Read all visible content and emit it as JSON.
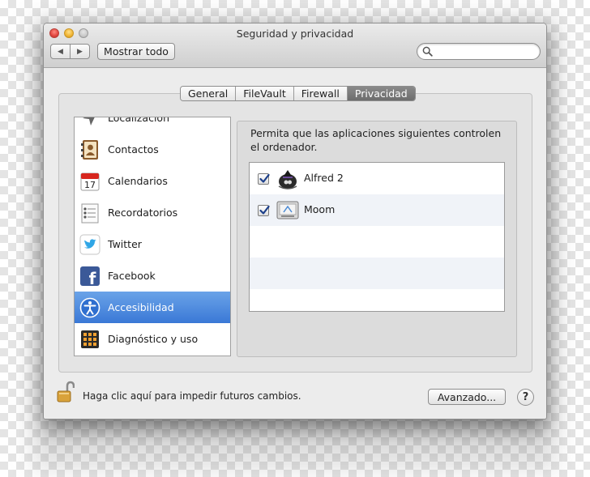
{
  "window": {
    "title": "Seguridad y privacidad",
    "nav_back": "◀",
    "nav_forward": "▶",
    "show_all_label": "Mostrar todo",
    "search": {
      "value": "",
      "placeholder": ""
    }
  },
  "tabs": [
    {
      "label": "General",
      "selected": false
    },
    {
      "label": "FileVault",
      "selected": false
    },
    {
      "label": "Firewall",
      "selected": false
    },
    {
      "label": "Privacidad",
      "selected": true
    }
  ],
  "categories": [
    {
      "label": "Localización",
      "icon": "location-icon"
    },
    {
      "label": "Contactos",
      "icon": "contacts-icon"
    },
    {
      "label": "Calendarios",
      "icon": "calendar-icon",
      "icon_text": "17"
    },
    {
      "label": "Recordatorios",
      "icon": "reminders-icon"
    },
    {
      "label": "Twitter",
      "icon": "twitter-icon"
    },
    {
      "label": "Facebook",
      "icon": "facebook-icon",
      "icon_text": "f"
    },
    {
      "label": "Accesibilidad",
      "icon": "accessibility-icon",
      "selected": true
    },
    {
      "label": "Diagnóstico y uso",
      "icon": "diagnostics-icon"
    }
  ],
  "permission_text": "Permita que las aplicaciones siguientes controlen el ordenador.",
  "apps": [
    {
      "name": "Alfred 2",
      "checked": true,
      "icon": "alfred-icon"
    },
    {
      "name": "Moom",
      "checked": true,
      "icon": "moom-icon"
    }
  ],
  "footer": {
    "lock_text": "Haga clic aquí para impedir futuros cambios.",
    "advanced_label": "Avanzado...",
    "help_label": "?"
  },
  "colors": {
    "selection": "#3a78d6",
    "active_tab": "#7a7a7a",
    "checkmark": "#1b3f8a"
  }
}
